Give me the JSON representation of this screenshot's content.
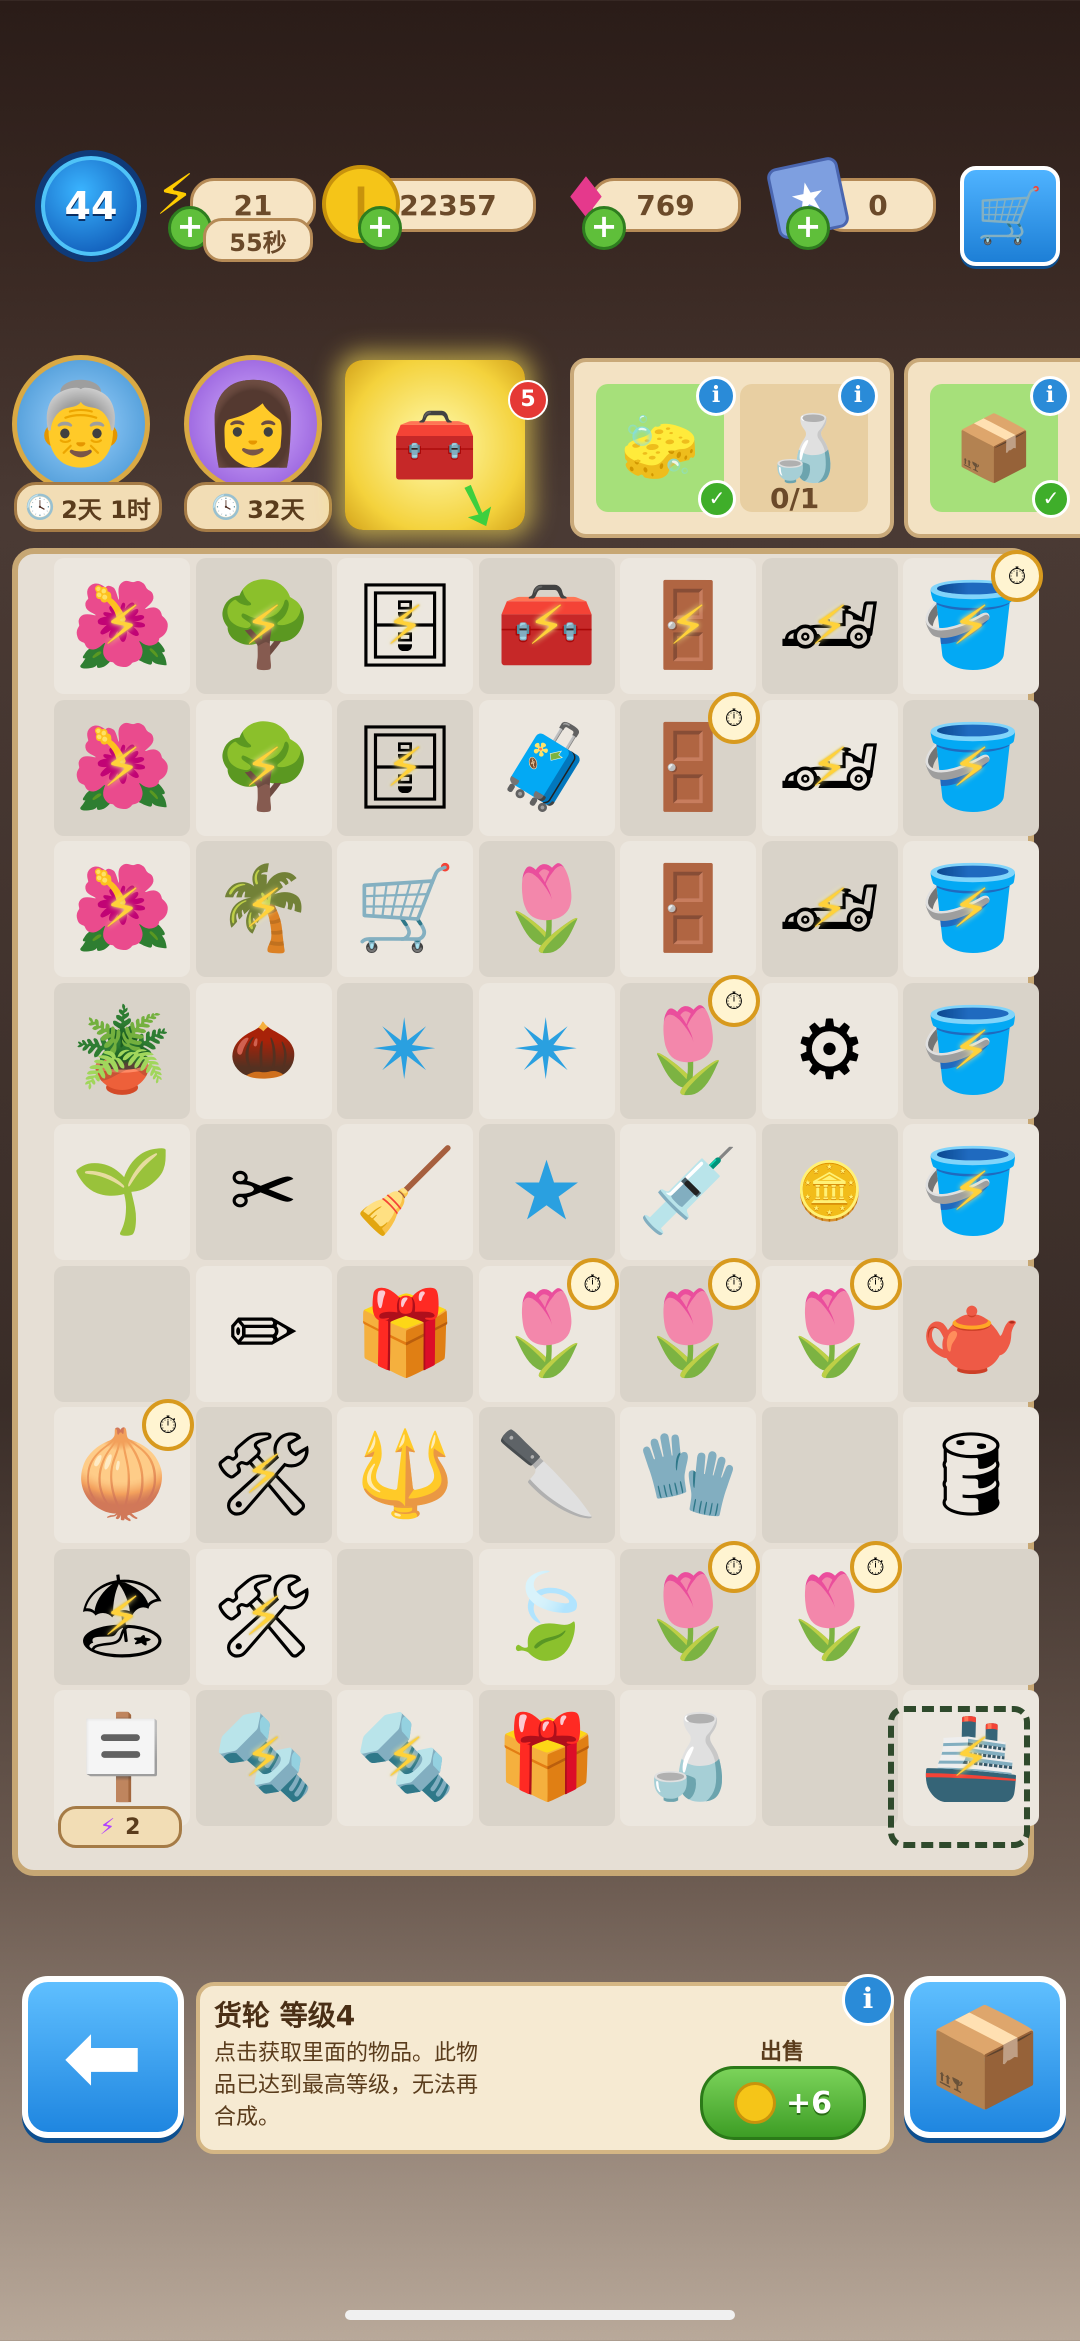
{
  "status_bar": {
    "level": "44",
    "energy": "21",
    "energy_timer": "55秒",
    "coins": "22357",
    "gems": "769",
    "stars": "0"
  },
  "events": [
    {
      "timer": "2天 1时"
    },
    {
      "timer": "32天"
    }
  ],
  "gift_badge_count": "5",
  "orders": {
    "bottle_progress": "0/1"
  },
  "board_energy_count": "2",
  "selected_item": {
    "title": "货轮 等级4",
    "description": "点击获取里面的物品。此物品已达到最高等级，无法再合成。",
    "sell_label": "出售",
    "sell_value": "+6"
  },
  "colors": {
    "accent_blue": "#1f86e0",
    "board_border": "#c7a774",
    "sell_green": "#3d9d25"
  }
}
